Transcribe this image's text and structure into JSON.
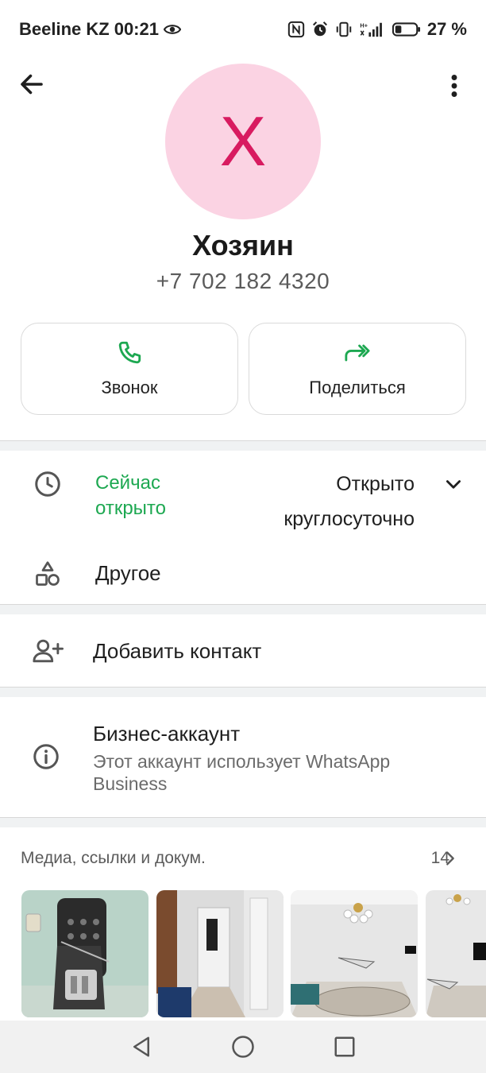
{
  "status_bar": {
    "carrier": "Beeline KZ",
    "time": "00:21",
    "battery": "27 %",
    "icons": [
      "eye-icon",
      "nfc-icon",
      "alarm-icon",
      "vibrate-icon",
      "signal-icon",
      "battery-icon"
    ]
  },
  "header": {
    "avatar_letter": "X",
    "name": "Хозяин",
    "phone": "+7 702 182 4320"
  },
  "actions": {
    "call_label": "Звонок",
    "share_label": "Поделиться"
  },
  "hours": {
    "status_line1": "Сейчас",
    "status_line2": "открыто",
    "hours_line1": "Открыто",
    "hours_line2": "круглосуточно"
  },
  "other_label": "Другое",
  "add_contact_label": "Добавить контакт",
  "business": {
    "title": "Бизнес-аккаунт",
    "line1": "Этот аккаунт использует WhatsApp",
    "line2": "Business"
  },
  "media": {
    "title": "Медиа, ссылки и докум.",
    "count": "14"
  },
  "colors": {
    "accent_green": "#1da851",
    "avatar_bg": "#fbd3e3",
    "avatar_letter": "#d81b60"
  }
}
